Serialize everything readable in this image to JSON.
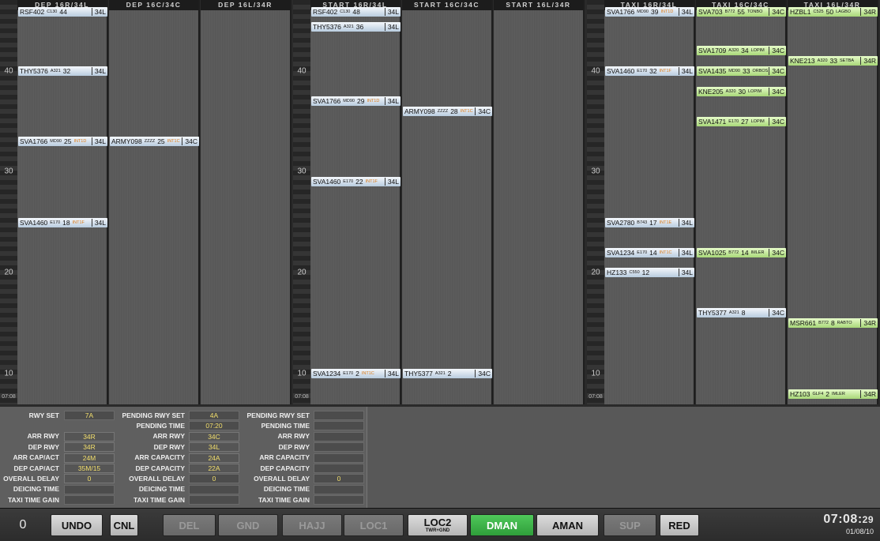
{
  "timelines": [
    {
      "id": "dep",
      "scale": {
        "ticks": [
          "40",
          "30",
          "20",
          "10"
        ],
        "time": "07:08"
      },
      "columns": [
        {
          "header": "DEP 16R/34L",
          "strips": [
            {
              "callsign": "RSF402",
              "type": "C130",
              "number": "44",
              "fix": "",
              "runway": "34L",
              "color": "blue",
              "minute": 45.9
            },
            {
              "callsign": "THY5376",
              "type": "A321",
              "number": "32",
              "fix": "",
              "runway": "34L",
              "color": "blue",
              "minute": 40.0
            },
            {
              "callsign": "SVA1766",
              "type": "MD90",
              "number": "25",
              "fix": "INT1D",
              "runway": "34L",
              "color": "blue",
              "minute": 33.0
            },
            {
              "callsign": "SVA1460",
              "type": "E170",
              "number": "18",
              "fix": "INT1F",
              "runway": "34L",
              "color": "blue",
              "minute": 25.0
            }
          ]
        },
        {
          "header": "DEP 16C/34C",
          "strips": [
            {
              "callsign": "ARMY098",
              "type": "ZZZZ",
              "number": "25",
              "fix": "INT1C",
              "runway": "34C",
              "color": "blue",
              "minute": 33.0
            }
          ]
        },
        {
          "header": "DEP 16L/34R",
          "strips": []
        }
      ]
    },
    {
      "id": "start",
      "scale": {
        "ticks": [
          "40",
          "30",
          "20",
          "10"
        ],
        "time": "07:08"
      },
      "columns": [
        {
          "header": "START 16R/34L",
          "strips": [
            {
              "callsign": "RSF402",
              "type": "C130",
              "number": "48",
              "fix": "",
              "runway": "34L",
              "color": "blue",
              "minute": 45.9
            },
            {
              "callsign": "THY5376",
              "type": "A321",
              "number": "36",
              "fix": "",
              "runway": "34L",
              "color": "blue",
              "minute": 44.4
            },
            {
              "callsign": "SVA1766",
              "type": "MD90",
              "number": "29",
              "fix": "INT1D",
              "runway": "34L",
              "color": "blue",
              "minute": 37.0
            },
            {
              "callsign": "SVA1460",
              "type": "E170",
              "number": "22",
              "fix": "INT1F",
              "runway": "34L",
              "color": "blue",
              "minute": 29.0
            },
            {
              "callsign": "SVA1234",
              "type": "E170",
              "number": "2",
              "fix": "INT1C",
              "runway": "34L",
              "color": "blue",
              "minute": 10.0
            }
          ]
        },
        {
          "header": "START 16C/34C",
          "strips": [
            {
              "callsign": "ARMY098",
              "type": "ZZZZ",
              "number": "28",
              "fix": "INT1C",
              "runway": "34C",
              "color": "blue",
              "minute": 36.0
            },
            {
              "callsign": "THY5377",
              "type": "A321",
              "number": "2",
              "fix": "",
              "runway": "34C",
              "color": "blue",
              "minute": 10.0
            }
          ]
        },
        {
          "header": "START 16L/34R",
          "strips": []
        }
      ]
    },
    {
      "id": "taxi",
      "scale": {
        "ticks": [
          "40",
          "30",
          "20",
          "10"
        ],
        "time": "07:08"
      },
      "columns": [
        {
          "header": "TAXI 16R/34L",
          "strips": [
            {
              "callsign": "SVA1766",
              "type": "MD90",
              "number": "39",
              "fix": "INT1D",
              "runway": "34L",
              "color": "blue",
              "minute": 45.9
            },
            {
              "callsign": "SVA1460",
              "type": "E170",
              "number": "32",
              "fix": "INT1F",
              "runway": "34L",
              "color": "blue",
              "minute": 40.0
            },
            {
              "callsign": "SVA2780",
              "type": "B743",
              "number": "17",
              "fix": "INT1E",
              "runway": "34L",
              "color": "blue",
              "minute": 25.0
            },
            {
              "callsign": "SVA1234",
              "type": "E170",
              "number": "14",
              "fix": "INT1C",
              "runway": "34L",
              "color": "blue",
              "minute": 22.0
            },
            {
              "callsign": "HZ133",
              "type": "C550",
              "number": "12",
              "fix": "",
              "runway": "34L",
              "color": "blue",
              "minute": 20.0
            }
          ]
        },
        {
          "header": "TAXI 16C/34C",
          "strips": [
            {
              "callsign": "SVA703",
              "type": "B772",
              "number": "55",
              "fix": "TONBO",
              "runway": "34C",
              "color": "green",
              "minute": 45.9
            },
            {
              "callsign": "SVA1709",
              "type": "A320",
              "number": "34",
              "fix": "LOPIM",
              "runway": "34C",
              "color": "green",
              "minute": 42.0
            },
            {
              "callsign": "SVA1435",
              "type": "MD90",
              "number": "33",
              "fix": "ORBOS",
              "runway": "34C",
              "color": "green",
              "minute": 40.0
            },
            {
              "callsign": "KNE205",
              "type": "A320",
              "number": "30",
              "fix": "LOPIM",
              "runway": "34C",
              "color": "green",
              "minute": 38.0
            },
            {
              "callsign": "SVA1471",
              "type": "E170",
              "number": "27",
              "fix": "LOPIM",
              "runway": "34C",
              "color": "green",
              "minute": 35.0
            },
            {
              "callsign": "SVA1025",
              "type": "B772",
              "number": "14",
              "fix": "IMLER",
              "runway": "34C",
              "color": "green",
              "minute": 22.0
            },
            {
              "callsign": "THY5377",
              "type": "A321",
              "number": "8",
              "fix": "",
              "runway": "34C",
              "color": "blue",
              "minute": 16.0
            }
          ]
        },
        {
          "header": "TAXI 16L/34R",
          "strips": [
            {
              "callsign": "HZBL1",
              "type": "C525",
              "number": "50",
              "fix": "LAGBO",
              "runway": "34R",
              "color": "green",
              "minute": 45.9
            },
            {
              "callsign": "KNE213",
              "type": "A320",
              "number": "33",
              "fix": "SETBA",
              "runway": "34R",
              "color": "green",
              "minute": 41.0
            },
            {
              "callsign": "MSR661",
              "type": "B772",
              "number": "8",
              "fix": "RABTO",
              "runway": "34R",
              "color": "green",
              "minute": 15.0
            },
            {
              "callsign": "HZ103",
              "type": "GLF4",
              "number": "2",
              "fix": "IMLER",
              "runway": "34R",
              "color": "green",
              "minute": 8.0
            }
          ]
        }
      ]
    }
  ],
  "panel": {
    "col1": [
      {
        "label": "RWY SET",
        "value": "7A"
      },
      {
        "label": "ARR RWY",
        "value": "34R"
      },
      {
        "label": "DEP RWY",
        "value": "34R"
      },
      {
        "label": "ARR CAP/ACT",
        "value": "24M"
      },
      {
        "label": "DEP CAP/ACT",
        "value": "35M/15"
      },
      {
        "label": "OVERALL DELAY",
        "value": "0"
      },
      {
        "label": "DEICING TIME",
        "value": ""
      },
      {
        "label": "TAXI TIME GAIN",
        "value": ""
      }
    ],
    "col2": [
      {
        "label": "PENDING RWY SET",
        "value": "4A"
      },
      {
        "label": "PENDING TIME",
        "value": "07:20"
      },
      {
        "label": "ARR RWY",
        "value": "34C"
      },
      {
        "label": "DEP RWY",
        "value": "34L"
      },
      {
        "label": "ARR CAPACITY",
        "value": "24A"
      },
      {
        "label": "DEP CAPACITY",
        "value": "22A"
      },
      {
        "label": "OVERALL DELAY",
        "value": "0"
      },
      {
        "label": "DEICING TIME",
        "value": ""
      },
      {
        "label": "TAXI TIME GAIN",
        "value": ""
      }
    ],
    "col3": [
      {
        "label": "PENDING RWY SET",
        "value": ""
      },
      {
        "label": "PENDING TIME",
        "value": ""
      },
      {
        "label": "ARR RWY",
        "value": ""
      },
      {
        "label": "DEP RWY",
        "value": ""
      },
      {
        "label": "ARR CAPACITY",
        "value": ""
      },
      {
        "label": "DEP CAPACITY",
        "value": ""
      },
      {
        "label": "OVERALL DELAY",
        "value": "0"
      },
      {
        "label": "DEICING TIME",
        "value": ""
      },
      {
        "label": "TAXI TIME GAIN",
        "value": ""
      }
    ]
  },
  "bottom": {
    "counter": "0",
    "buttons": [
      {
        "label": "UNDO",
        "sub": "",
        "state": "on",
        "name": "undo-button"
      },
      {
        "label": "CNL",
        "sub": "",
        "state": "on",
        "name": "cnl-button"
      },
      {
        "label": "DEL",
        "sub": "",
        "state": "off",
        "name": "del-button"
      },
      {
        "label": "GND",
        "sub": "",
        "state": "off",
        "name": "gnd-button"
      },
      {
        "label": "HAJJ",
        "sub": "",
        "state": "off",
        "name": "hajj-button"
      },
      {
        "label": "LOC1",
        "sub": "",
        "state": "off",
        "name": "loc1-button"
      },
      {
        "label": "LOC2",
        "sub": "TWR+GND",
        "state": "on",
        "name": "loc2-button"
      },
      {
        "label": "DMAN",
        "sub": "",
        "state": "active",
        "name": "dman-button"
      },
      {
        "label": "AMAN",
        "sub": "",
        "state": "on",
        "name": "aman-button"
      },
      {
        "label": "SUP",
        "sub": "",
        "state": "off",
        "name": "sup-button"
      },
      {
        "label": "RED",
        "sub": "",
        "state": "on",
        "name": "red-button"
      }
    ],
    "clock": {
      "hm": "07:08:",
      "sec": "29",
      "date": "01/08/10"
    }
  }
}
